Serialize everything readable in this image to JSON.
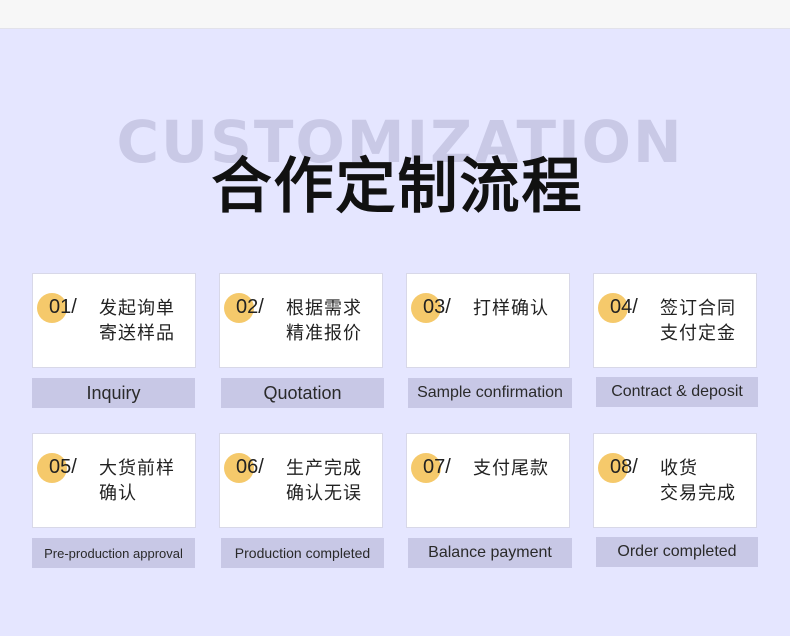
{
  "header": {
    "background_word": "CUSTOMIZATION",
    "title": "合作定制流程"
  },
  "colors": {
    "background": "#e5e6ff",
    "card": "#ffffff",
    "label_bar": "#c8c8e6",
    "number_dot": "#f5c96b"
  },
  "steps": [
    {
      "num": "01/",
      "line1": "发起询单",
      "line2": "寄送样品",
      "label": "Inquiry"
    },
    {
      "num": "02/",
      "line1": "根据需求",
      "line2": "精准报价",
      "label": "Quotation"
    },
    {
      "num": "03/",
      "line1": "打样确认",
      "line2": "",
      "label": "Sample confirmation"
    },
    {
      "num": "04/",
      "line1": "签订合同",
      "line2": "支付定金",
      "label": "Contract & deposit"
    },
    {
      "num": "05/",
      "line1": "大货前样",
      "line2": "确认",
      "label": "Pre-production approval"
    },
    {
      "num": "06/",
      "line1": "生产完成",
      "line2": "确认无误",
      "label": "Production completed"
    },
    {
      "num": "07/",
      "line1": "支付尾款",
      "line2": "",
      "label": "Balance payment"
    },
    {
      "num": "08/",
      "line1": "收货",
      "line2": "交易完成",
      "label": "Order completed"
    }
  ]
}
